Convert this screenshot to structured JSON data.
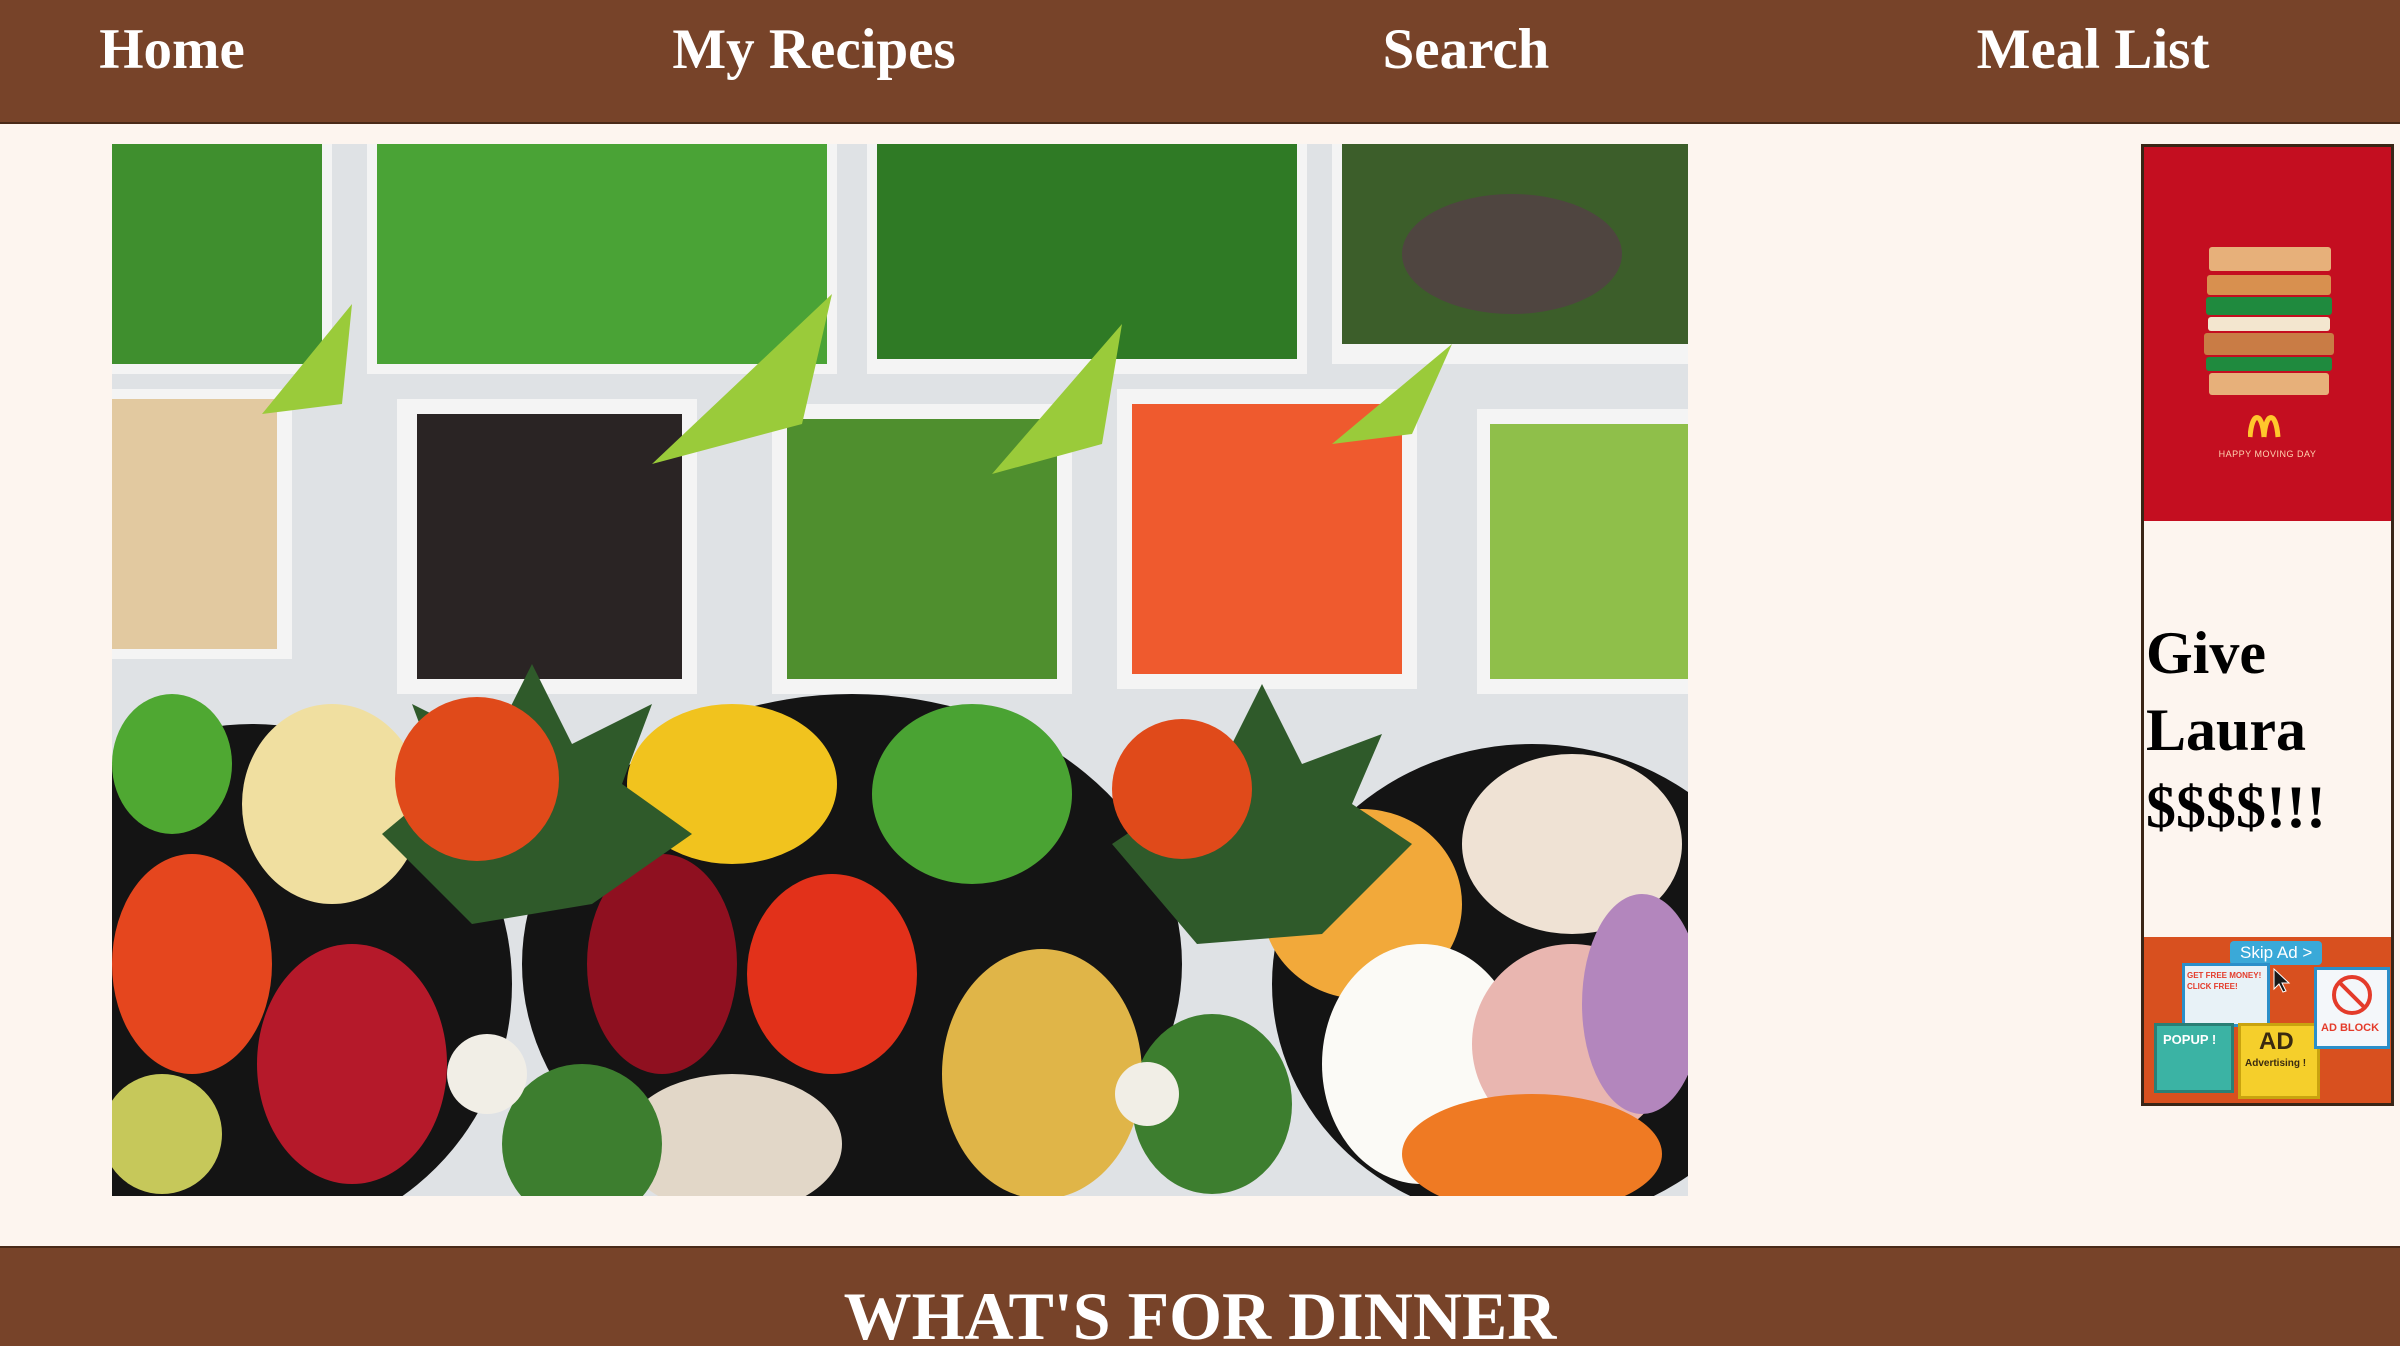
{
  "nav": {
    "home": "Home",
    "my_recipes": "My Recipes",
    "search": "Search",
    "meal_list": "Meal List"
  },
  "hero": {
    "image_icon": "salad-bar-photo"
  },
  "ad": {
    "brand_icon": "mcdonalds-logo-icon",
    "tagline": "HAPPY MOVING DAY",
    "text_lines": [
      "Give",
      "Laura",
      "$$$$!!!"
    ],
    "skip_label": "Skip Ad >",
    "free_money_label": "GET FREE MONEY! CLICK FREE!",
    "popup_label": "POPUP !",
    "ad_label": "AD",
    "advertising_label": "Advertising !",
    "adblock_label": "AD BLOCK"
  },
  "footer": {
    "title": "WHAT'S FOR DINNER"
  },
  "colors": {
    "nav_background": "#774329",
    "page_background": "#fdf5ef",
    "ad_red": "#c40e20",
    "ad_orange": "#d8501f"
  }
}
